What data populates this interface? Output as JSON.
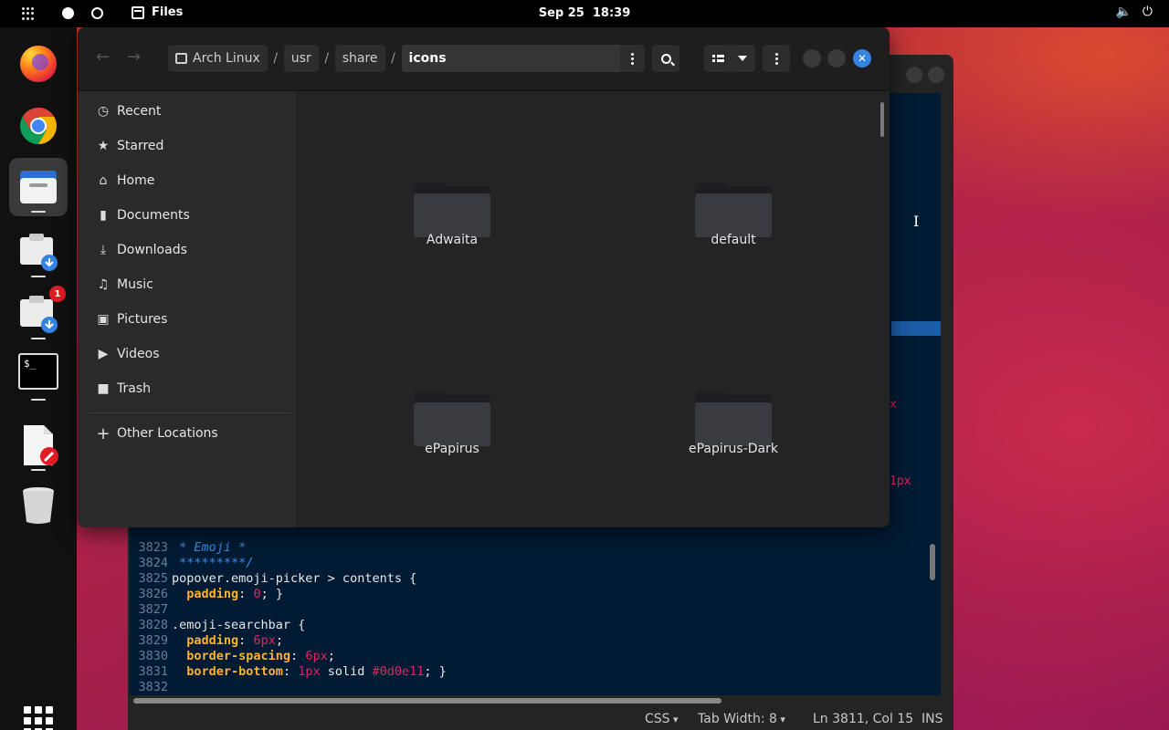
{
  "topbar": {
    "app_name": "Files",
    "date": "Sep 25",
    "time": "18:39",
    "volume_icon": "🔈",
    "power_icon": "⏻"
  },
  "dock": {
    "items": [
      "firefox-icon",
      "chrome-icon",
      "files-icon",
      "downloader-icon",
      "downloader-icon",
      "terminal-icon",
      "text-editor-icon",
      "trash-icon"
    ],
    "badge_count": "1",
    "terminal_prompt": "$_"
  },
  "editor": {
    "code_lines": [
      {
        "num": "3823",
        "parts": [
          {
            "t": " * Emoji *",
            "c": "c"
          }
        ]
      },
      {
        "num": "3824",
        "parts": [
          {
            "t": " *********/",
            "c": "c"
          }
        ]
      },
      {
        "num": "3825",
        "parts": [
          {
            "t": "popover.emoji-picker > contents {",
            "c": ""
          }
        ]
      },
      {
        "num": "3826",
        "parts": [
          {
            "t": "  ",
            "c": ""
          },
          {
            "t": "padding",
            "c": "p"
          },
          {
            "t": ": ",
            "c": ""
          },
          {
            "t": "0",
            "c": "n"
          },
          {
            "t": "; }",
            "c": ""
          }
        ]
      },
      {
        "num": "3827",
        "parts": []
      },
      {
        "num": "3828",
        "parts": [
          {
            "t": ".emoji-searchbar {",
            "c": ""
          }
        ]
      },
      {
        "num": "3829",
        "parts": [
          {
            "t": "  ",
            "c": ""
          },
          {
            "t": "padding",
            "c": "p"
          },
          {
            "t": ": ",
            "c": ""
          },
          {
            "t": "6px",
            "c": "n"
          },
          {
            "t": ";",
            "c": ""
          }
        ]
      },
      {
        "num": "3830",
        "parts": [
          {
            "t": "  ",
            "c": ""
          },
          {
            "t": "border-spacing",
            "c": "p"
          },
          {
            "t": ": ",
            "c": ""
          },
          {
            "t": "6px",
            "c": "n"
          },
          {
            "t": ";",
            "c": ""
          }
        ]
      },
      {
        "num": "3831",
        "parts": [
          {
            "t": "  ",
            "c": ""
          },
          {
            "t": "border-bottom",
            "c": "p"
          },
          {
            "t": ": ",
            "c": ""
          },
          {
            "t": "1px",
            "c": "n"
          },
          {
            "t": " solid ",
            "c": ""
          },
          {
            "t": "#0d0e11",
            "c": "n"
          },
          {
            "t": "; }",
            "c": ""
          }
        ]
      },
      {
        "num": "3832",
        "parts": []
      }
    ],
    "fragment_x": "x",
    "fragment_1px": "1px",
    "status": {
      "language": "CSS",
      "tab_width": "Tab Width: 8",
      "position": "Ln 3811, Col 15",
      "mode": "INS"
    }
  },
  "files": {
    "path": [
      "Arch Linux",
      "usr",
      "share",
      "icons"
    ],
    "close_glyph": "✕",
    "back_glyph": "←",
    "forward_glyph": "→",
    "sidebar": [
      {
        "label": "Recent",
        "icon": "◷",
        "name": "recent"
      },
      {
        "label": "Starred",
        "icon": "★",
        "name": "starred"
      },
      {
        "label": "Home",
        "icon": "⌂",
        "name": "home"
      },
      {
        "label": "Documents",
        "icon": "▮",
        "name": "documents"
      },
      {
        "label": "Downloads",
        "icon": "⤓",
        "name": "downloads"
      },
      {
        "label": "Music",
        "icon": "♫",
        "name": "music"
      },
      {
        "label": "Pictures",
        "icon": "▣",
        "name": "pictures"
      },
      {
        "label": "Videos",
        "icon": "▶",
        "name": "videos"
      },
      {
        "label": "Trash",
        "icon": "■",
        "name": "trash"
      }
    ],
    "other_locations": {
      "label": "Other Locations",
      "icon": "+"
    },
    "folders": [
      "Adwaita",
      "default",
      "ePapirus",
      "ePapirus-Dark"
    ]
  },
  "colors": {
    "accent": "#3584e4",
    "code_bg": "#001b33",
    "code_property": "#ffb22e",
    "code_value": "#e0245e",
    "code_comment": "#3b8de0"
  }
}
